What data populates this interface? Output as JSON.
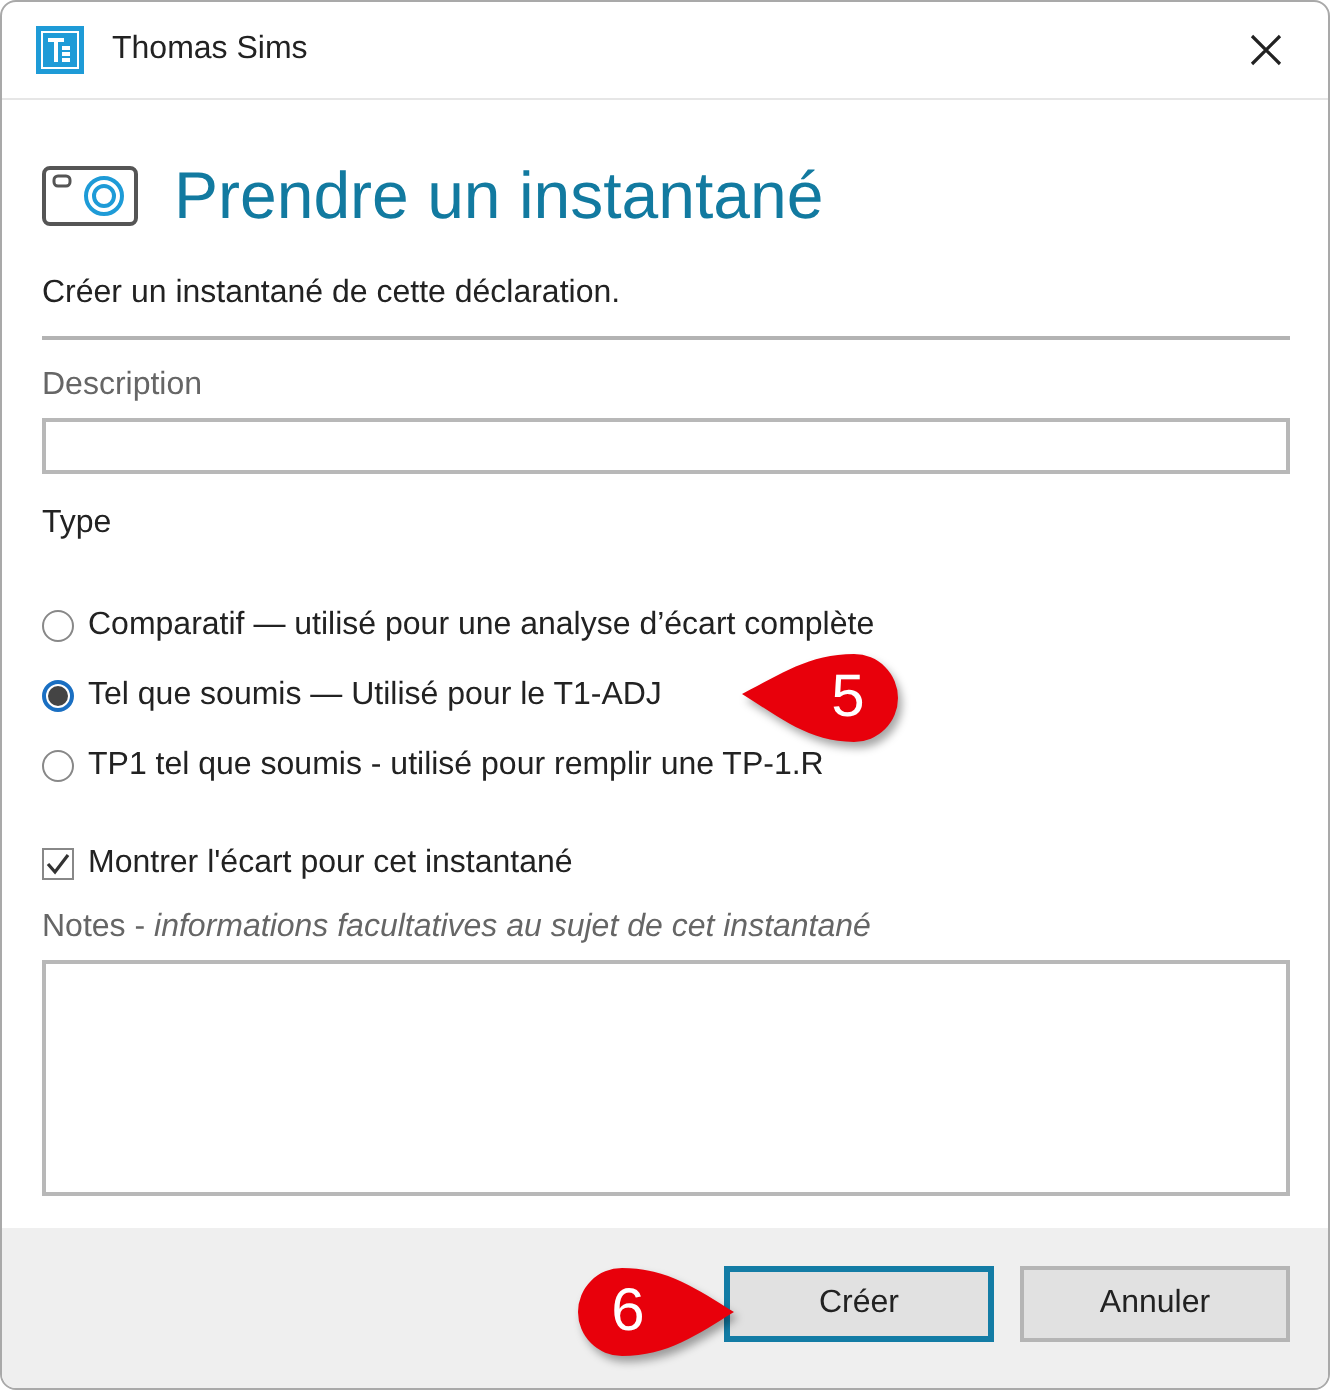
{
  "window": {
    "title": "Thomas Sims"
  },
  "heading": "Prendre un instantané",
  "intro": "Créer un instantané de cette déclaration.",
  "description": {
    "label": "Description"
  },
  "type": {
    "label": "Type",
    "options": [
      {
        "label": "Comparatif — utilisé pour une analyse d’écart complète",
        "selected": false
      },
      {
        "label": "Tel que soumis — Utilisé pour le T1-ADJ",
        "selected": true
      },
      {
        "label": "TP1 tel que soumis - utilisé pour remplir une TP-1.R",
        "selected": false
      }
    ]
  },
  "show_gap": {
    "label": "Montrer l'écart pour cet instantané",
    "checked": true
  },
  "notes": {
    "label": "Notes - *informations facultatives au sujet de cet instantané*"
  },
  "buttons": [
    {
      "label": "Créer",
      "default": true
    },
    {
      "label": "Annuler",
      "default": false
    }
  ],
  "callouts": [
    {
      "number": "5",
      "kind": "left"
    },
    {
      "number": "6",
      "kind": "right"
    }
  ]
}
